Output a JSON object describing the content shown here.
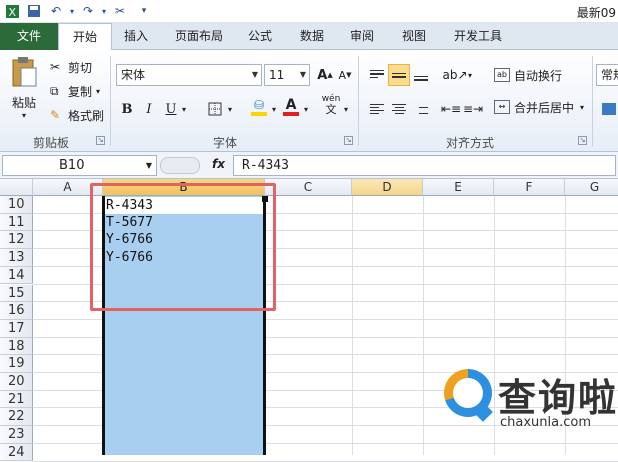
{
  "window": {
    "title": "最新09"
  },
  "tabs": [
    "文件",
    "开始",
    "插入",
    "页面布局",
    "公式",
    "数据",
    "审阅",
    "视图",
    "开发工具"
  ],
  "clipboard": {
    "paste": "粘贴",
    "cut": "剪切",
    "copy": "复制",
    "format_painter": "格式刷",
    "group": "剪贴板"
  },
  "font": {
    "name": "宋体",
    "size": "11",
    "bold": "B",
    "italic": "I",
    "underline": "U",
    "font_color_letter": "A",
    "pinyin_glyph": "wén",
    "group": "字体"
  },
  "alignment": {
    "wrap_text": "自动换行",
    "merge_center": "合并后居中",
    "group": "对齐方式"
  },
  "number": {
    "format": "常规"
  },
  "formula_bar": {
    "name_box": "B10",
    "fx": "fx",
    "content": "R-4343"
  },
  "grid": {
    "columns": [
      "A",
      "B",
      "C",
      "D",
      "E",
      "F",
      "G"
    ],
    "selected_column": "B",
    "rows": [
      "10",
      "11",
      "12",
      "13",
      "14",
      "15",
      "16",
      "17",
      "18",
      "19",
      "20",
      "21",
      "22",
      "23",
      "24"
    ],
    "cells_b": [
      "R-4343",
      "T-5677",
      "Y-6766",
      "Y-6766"
    ]
  },
  "colors": {
    "file_tab": "#2b6b3a",
    "selection": "#a8cff0",
    "highlight_box": "#e06464",
    "font_color": "#e02020",
    "fill_color": "#ffd200"
  },
  "watermark": {
    "name": "查询啦",
    "url": "chaxunla.com"
  }
}
